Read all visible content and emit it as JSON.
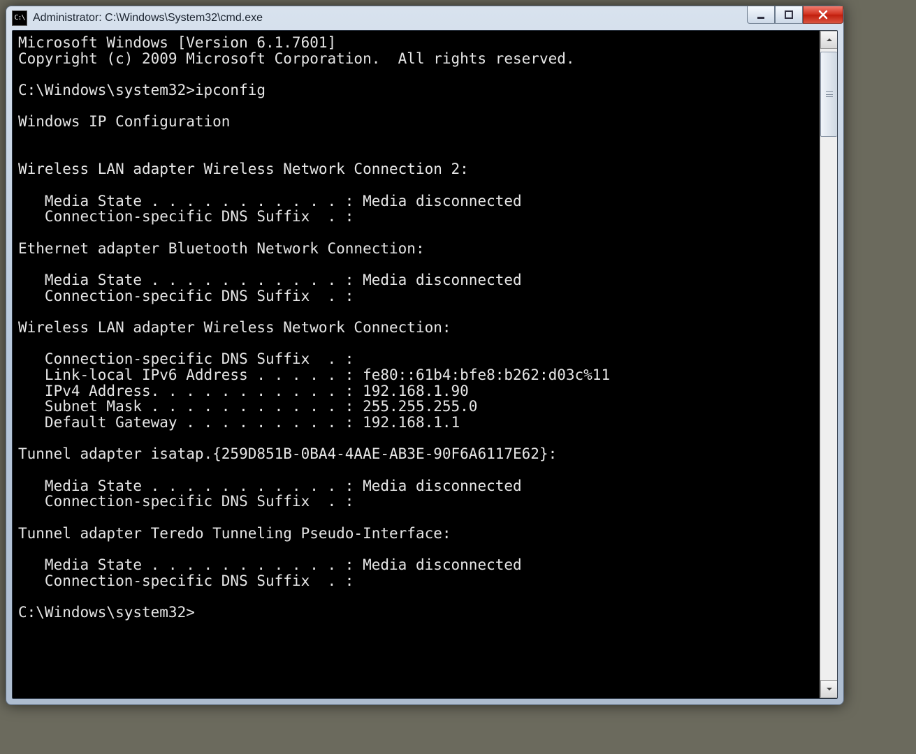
{
  "window": {
    "icon_label": "C:\\",
    "title": "Administrator: C:\\Windows\\System32\\cmd.exe"
  },
  "console": {
    "lines": [
      "Microsoft Windows [Version 6.1.7601]",
      "Copyright (c) 2009 Microsoft Corporation.  All rights reserved.",
      "",
      "C:\\Windows\\system32>ipconfig",
      "",
      "Windows IP Configuration",
      "",
      "",
      "Wireless LAN adapter Wireless Network Connection 2:",
      "",
      "   Media State . . . . . . . . . . . : Media disconnected",
      "   Connection-specific DNS Suffix  . :",
      "",
      "Ethernet adapter Bluetooth Network Connection:",
      "",
      "   Media State . . . . . . . . . . . : Media disconnected",
      "   Connection-specific DNS Suffix  . :",
      "",
      "Wireless LAN adapter Wireless Network Connection:",
      "",
      "   Connection-specific DNS Suffix  . :",
      "   Link-local IPv6 Address . . . . . : fe80::61b4:bfe8:b262:d03c%11",
      "   IPv4 Address. . . . . . . . . . . : 192.168.1.90",
      "   Subnet Mask . . . . . . . . . . . : 255.255.255.0",
      "   Default Gateway . . . . . . . . . : 192.168.1.1",
      "",
      "Tunnel adapter isatap.{259D851B-0BA4-4AAE-AB3E-90F6A6117E62}:",
      "",
      "   Media State . . . . . . . . . . . : Media disconnected",
      "   Connection-specific DNS Suffix  . :",
      "",
      "Tunnel adapter Teredo Tunneling Pseudo-Interface:",
      "",
      "   Media State . . . . . . . . . . . : Media disconnected",
      "   Connection-specific DNS Suffix  . :",
      "",
      "C:\\Windows\\system32>"
    ]
  }
}
